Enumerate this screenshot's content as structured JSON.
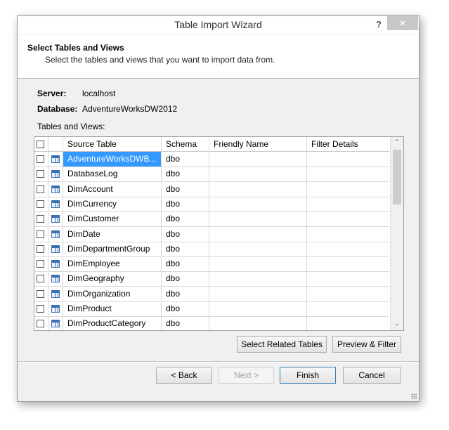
{
  "window": {
    "title": "Table Import Wizard",
    "help_label": "?",
    "close_label": "✕"
  },
  "header": {
    "title": "Select Tables and Views",
    "subtitle": "Select the tables and views that you want to import data from."
  },
  "connection": {
    "server_label": "Server:",
    "server_value": "localhost",
    "database_label": "Database:",
    "database_value": "AdventureWorksDW2012"
  },
  "tables_label": "Tables and Views:",
  "grid": {
    "columns": [
      "Source Table",
      "Schema",
      "Friendly Name",
      "Filter Details"
    ],
    "rows": [
      {
        "source": "AdventureWorksDWB...",
        "schema": "dbo",
        "friendly": "",
        "filter": "",
        "selected": true,
        "checked": false
      },
      {
        "source": "DatabaseLog",
        "schema": "dbo",
        "friendly": "",
        "filter": "",
        "selected": false,
        "checked": false
      },
      {
        "source": "DimAccount",
        "schema": "dbo",
        "friendly": "",
        "filter": "",
        "selected": false,
        "checked": false
      },
      {
        "source": "DimCurrency",
        "schema": "dbo",
        "friendly": "",
        "filter": "",
        "selected": false,
        "checked": false
      },
      {
        "source": "DimCustomer",
        "schema": "dbo",
        "friendly": "",
        "filter": "",
        "selected": false,
        "checked": false
      },
      {
        "source": "DimDate",
        "schema": "dbo",
        "friendly": "",
        "filter": "",
        "selected": false,
        "checked": false
      },
      {
        "source": "DimDepartmentGroup",
        "schema": "dbo",
        "friendly": "",
        "filter": "",
        "selected": false,
        "checked": false
      },
      {
        "source": "DimEmployee",
        "schema": "dbo",
        "friendly": "",
        "filter": "",
        "selected": false,
        "checked": false
      },
      {
        "source": "DimGeography",
        "schema": "dbo",
        "friendly": "",
        "filter": "",
        "selected": false,
        "checked": false
      },
      {
        "source": "DimOrganization",
        "schema": "dbo",
        "friendly": "",
        "filter": "",
        "selected": false,
        "checked": false
      },
      {
        "source": "DimProduct",
        "schema": "dbo",
        "friendly": "",
        "filter": "",
        "selected": false,
        "checked": false
      },
      {
        "source": "DimProductCategory",
        "schema": "dbo",
        "friendly": "",
        "filter": "",
        "selected": false,
        "checked": false
      }
    ],
    "scroll_up": "⌃",
    "scroll_down": "⌄"
  },
  "actions": {
    "select_related": "Select Related Tables",
    "preview_filter": "Preview & Filter"
  },
  "footer": {
    "back": "< Back",
    "next": "Next >",
    "finish": "Finish",
    "cancel": "Cancel"
  },
  "colors": {
    "selection": "#3399ff",
    "dialog_bg": "#f0f0f0",
    "close_bg": "#c7c7c7"
  }
}
